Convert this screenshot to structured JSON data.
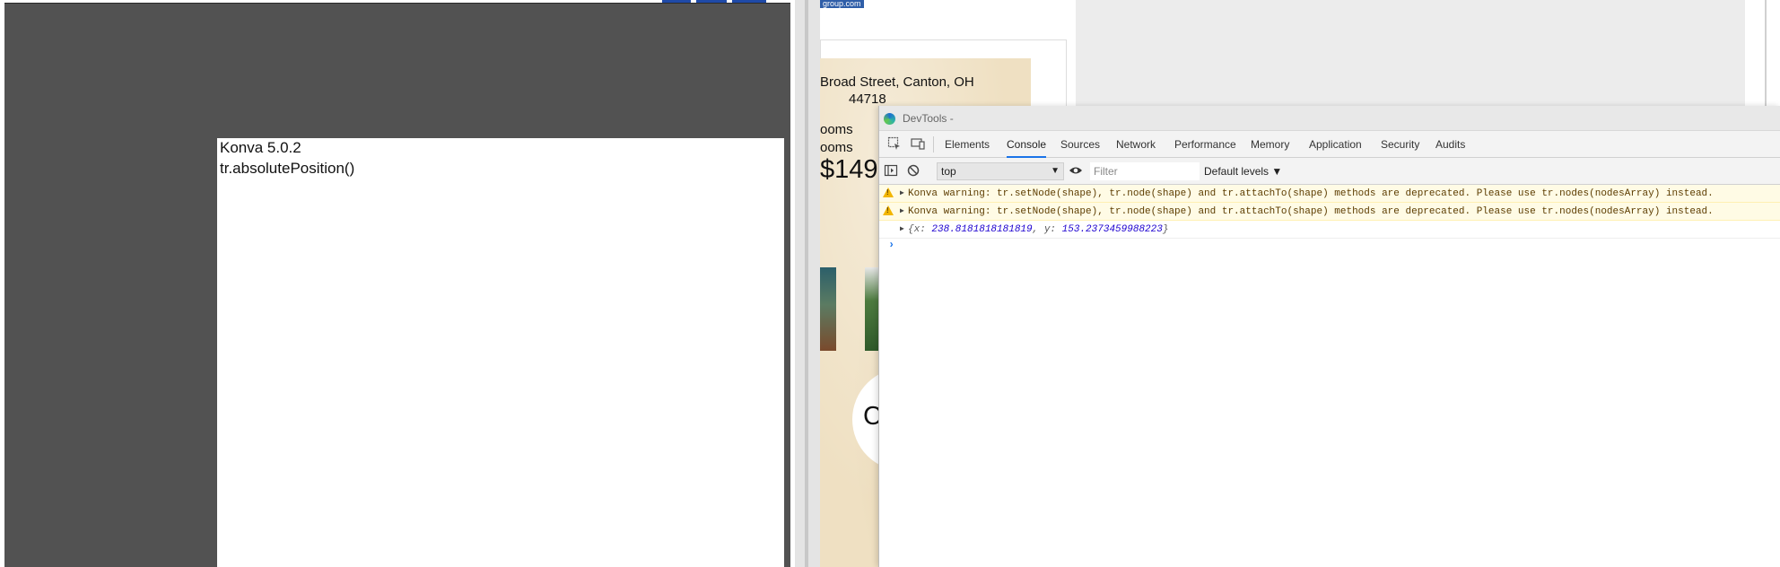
{
  "left_app": {
    "stage_lines": [
      "Konva 5.0.2",
      "tr.absolutePosition()"
    ]
  },
  "site": {
    "selected_url": "group.com",
    "address_line1": "Broad Street, Canton, OH",
    "address_line2": "44718",
    "rooms_line1": "ooms",
    "rooms_line2": "ooms",
    "price": "$149",
    "blob_letter": "C"
  },
  "devtools": {
    "title": "DevTools - ",
    "tabs": [
      "Elements",
      "Console",
      "Sources",
      "Network",
      "Performance",
      "Memory",
      "Application",
      "Security",
      "Audits"
    ],
    "active_tab": "Console",
    "context": "top",
    "filter_placeholder": "Filter",
    "levels": "Default levels ▼",
    "console": {
      "warning_1": "Konva warning: tr.setNode(shape), tr.node(shape) and tr.attachTo(shape) methods are deprecated. Please use tr.nodes(nodesArray) instead.",
      "warning_2": "Konva warning: tr.setNode(shape), tr.node(shape) and tr.attachTo(shape) methods are deprecated. Please use tr.nodes(nodesArray) instead.",
      "object_open": "{x: ",
      "object_x": "238.8181818181819",
      "object_sep": ", y: ",
      "object_y": "153.2373459988223",
      "object_close": "}",
      "prompt": "›"
    }
  },
  "colors": {
    "dark_canvas": "#525252",
    "warning_bg": "#fffbe5",
    "warning_icon": "#f2b600",
    "active_tab_underline": "#1a73e8",
    "parchment": "#efe0c2"
  },
  "icons": [
    "inspect-icon",
    "device-toolbar-icon",
    "sidebar-toggle-icon",
    "clear-console-icon",
    "eye-icon",
    "warning-icon",
    "edge-logo-icon"
  ]
}
